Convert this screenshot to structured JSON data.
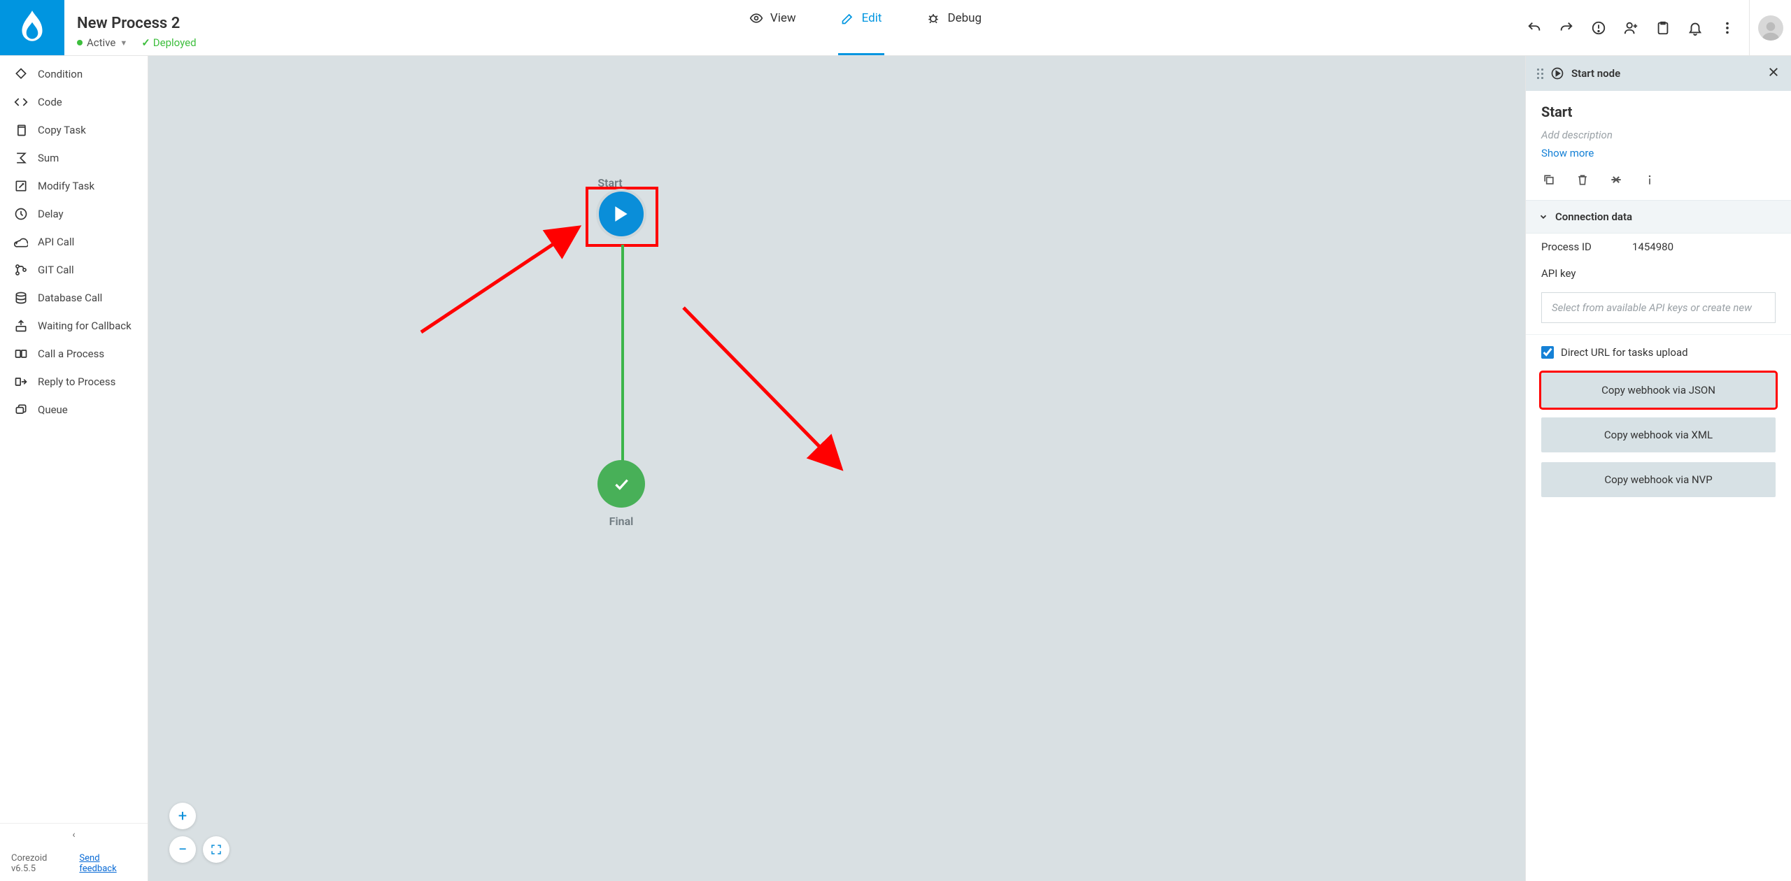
{
  "header": {
    "title": "New Process 2",
    "status_active": "Active",
    "status_deployed": "Deployed",
    "tabs": {
      "view": "View",
      "edit": "Edit",
      "debug": "Debug"
    }
  },
  "sidebar": {
    "items": [
      "Condition",
      "Code",
      "Copy Task",
      "Sum",
      "Modify Task",
      "Delay",
      "API Call",
      "GIT Call",
      "Database Call",
      "Waiting for Callback",
      "Call a Process",
      "Reply to Process",
      "Queue"
    ],
    "version": "Corezoid v6.5.5",
    "feedback": "Send feedback"
  },
  "canvas": {
    "start_label": "Start",
    "final_label": "Final"
  },
  "panel": {
    "header_title": "Start node",
    "title": "Start",
    "desc_placeholder": "Add description",
    "show_more": "Show more",
    "accordion": "Connection data",
    "process_id_label": "Process ID",
    "process_id_value": "1454980",
    "api_key_label": "API key",
    "api_key_placeholder": "Select from available API keys or create new",
    "direct_url_label": "Direct URL for tasks upload",
    "btn_json": "Copy webhook via JSON",
    "btn_xml": "Copy webhook via XML",
    "btn_nvp": "Copy webhook via NVP"
  }
}
